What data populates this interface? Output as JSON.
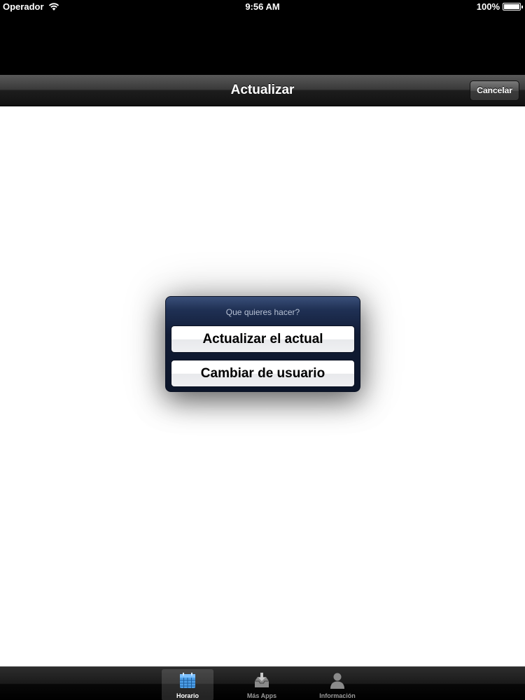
{
  "status_bar": {
    "carrier": "Operador",
    "time": "9:56 AM",
    "battery": "100%",
    "battery_level": 1.0,
    "icons": [
      "wifi-icon",
      "battery-icon"
    ]
  },
  "nav_bar": {
    "title": "Actualizar",
    "cancel_label": "Cancelar"
  },
  "action_sheet": {
    "title": "Que quieres hacer?",
    "buttons": [
      "Actualizar el actual",
      "Cambiar de usuario"
    ]
  },
  "tab_bar": {
    "selected": "Horario",
    "items": [
      {
        "label": "Horario",
        "icon": "calendar-icon"
      },
      {
        "label": "Más Apps",
        "icon": "download-tray-icon"
      },
      {
        "label": "Información",
        "icon": "person-icon"
      }
    ]
  },
  "colors": {
    "sheet_background": "#111c35",
    "selected_tab_icon": "#5aa9f2"
  }
}
